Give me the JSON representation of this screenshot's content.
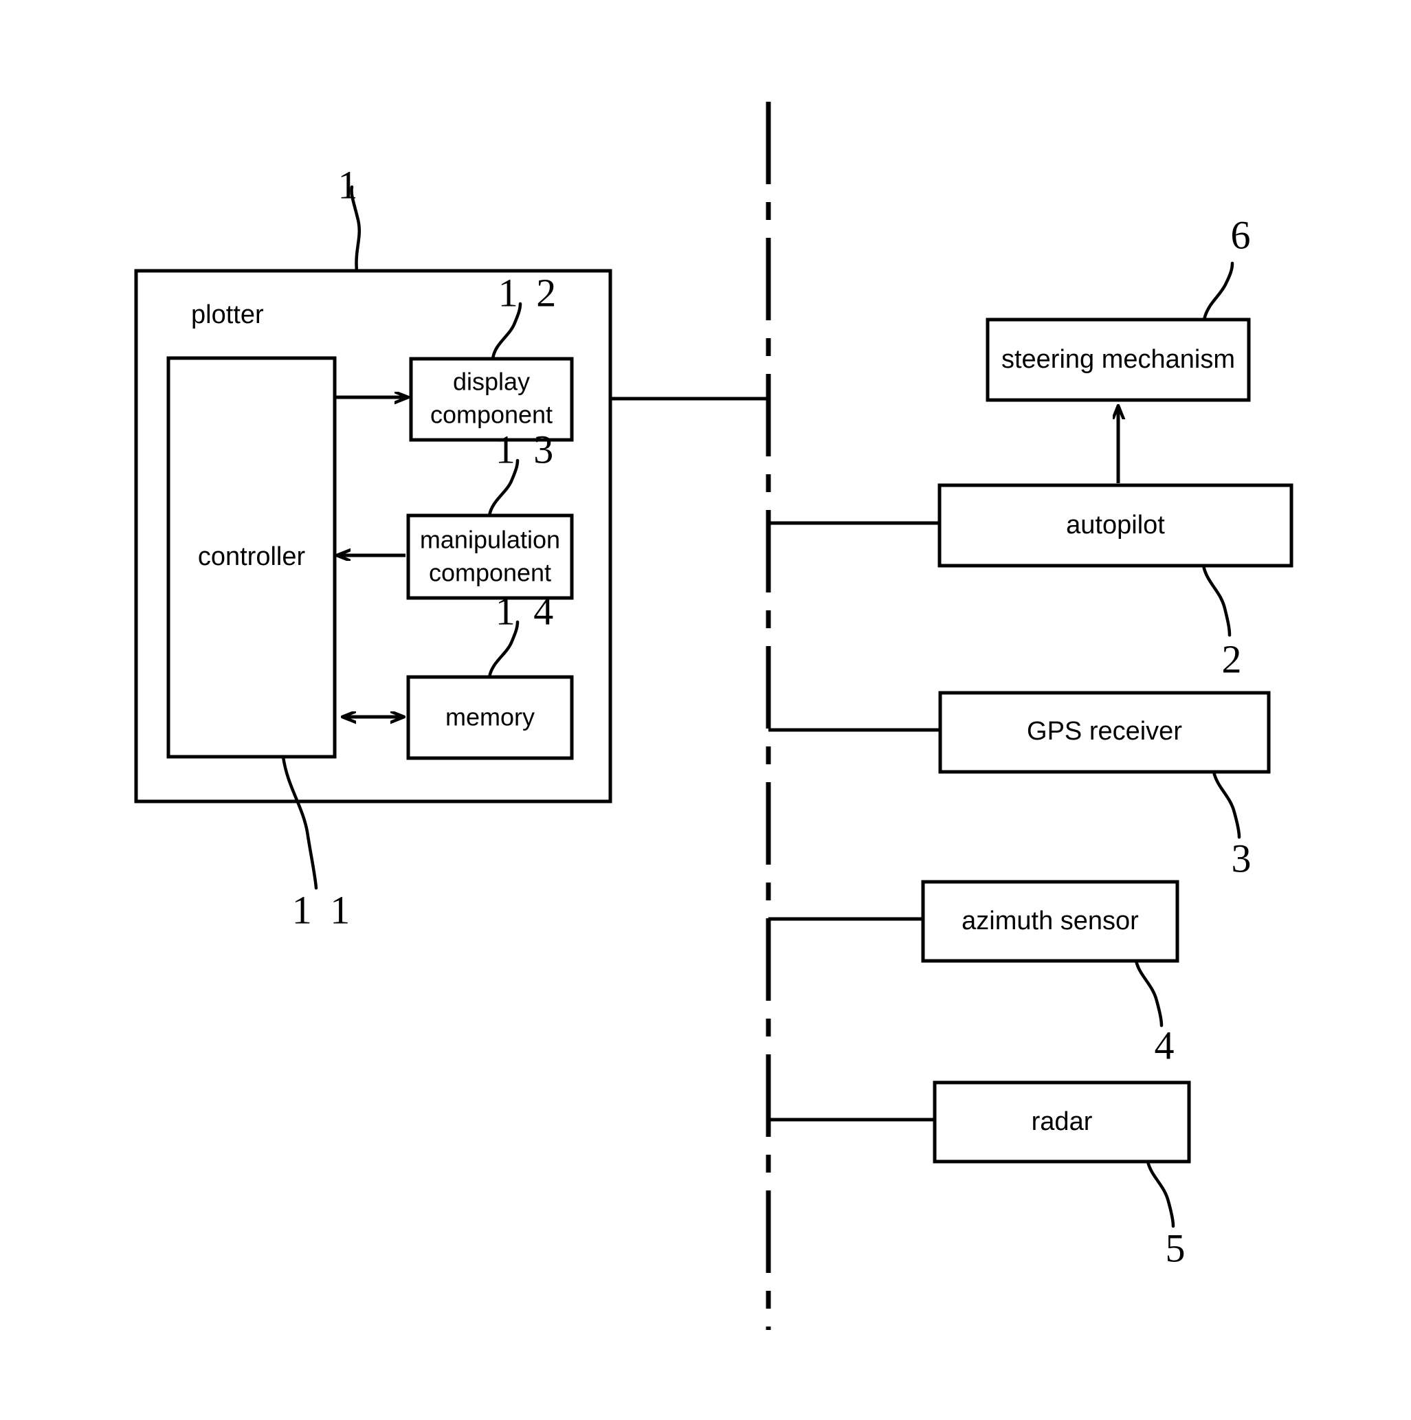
{
  "figure": {
    "type": "patent-block-diagram",
    "background_color": "#ffffff",
    "line_color": "#000000"
  },
  "plotter_group": {
    "caption": "plotter",
    "reference_numeral": "1",
    "controller": {
      "label": "controller",
      "reference_numeral": "1 1"
    },
    "components": [
      {
        "label_line1": "display",
        "label_line2": "component",
        "reference_numeral": "1 2"
      },
      {
        "label_line1": "manipulation",
        "label_line2": "component",
        "reference_numeral": "1 3"
      },
      {
        "label_line1": "memory",
        "label_line2": "",
        "reference_numeral": "1 4"
      }
    ]
  },
  "external_units": [
    {
      "label": "steering mechanism",
      "reference_numeral": "6"
    },
    {
      "label": "autopilot",
      "reference_numeral": "2"
    },
    {
      "label": "GPS receiver",
      "reference_numeral": "3"
    },
    {
      "label": "azimuth sensor",
      "reference_numeral": "4"
    },
    {
      "label": "radar",
      "reference_numeral": "5"
    }
  ]
}
